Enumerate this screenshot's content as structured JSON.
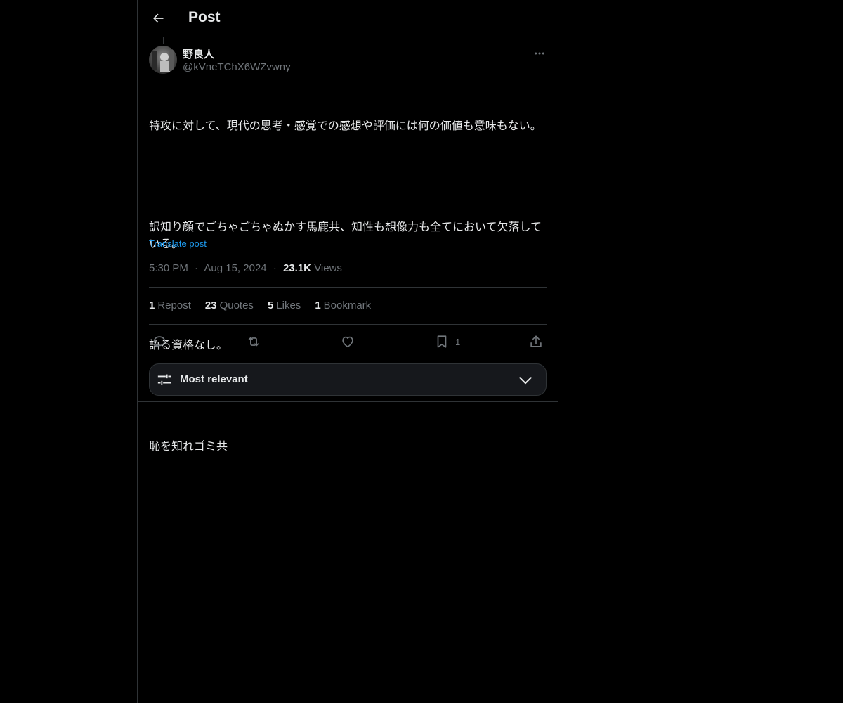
{
  "header": {
    "back_icon": "arrow-left-icon",
    "title": "Post"
  },
  "post": {
    "author": {
      "name": "野良人",
      "handle": "@kVneTChX6WZvwny",
      "avatar_icon": "avatar-photo"
    },
    "more_icon": "more-horizontal-icon",
    "paragraphs": [
      "特攻に対して、現代の思考・感覚での感想や評価には何の価値も意味もない。",
      "訳知り顔でごちゃごちゃぬかす馬鹿共、知性も想像力も全てにおいて欠落している。",
      "語る資格なし。",
      "恥を知れゴミ共"
    ],
    "translate_label": "Translate post",
    "time": "5:30 PM",
    "date": "Aug 15, 2024",
    "dot": "·",
    "views_count": "23.1K",
    "views_label": "Views"
  },
  "stats": {
    "reposts": {
      "num": "1",
      "label": "Repost"
    },
    "quotes": {
      "num": "23",
      "label": "Quotes"
    },
    "likes": {
      "num": "5",
      "label": "Likes"
    },
    "bookmarks": {
      "num": "1",
      "label": "Bookmark"
    }
  },
  "actions": {
    "reply_icon": "reply-icon",
    "repost_icon": "repost-icon",
    "like_icon": "heart-icon",
    "bookmark_icon": "bookmark-icon",
    "bookmark_count": "1",
    "share_icon": "share-icon"
  },
  "sort": {
    "icon": "sliders-icon",
    "label": "Most relevant",
    "chevron_icon": "chevron-down-icon"
  },
  "colors": {
    "background": "#000000",
    "text_primary": "#e7e9ea",
    "text_secondary": "#71767b",
    "accent": "#1d9bf0",
    "border": "#2f3336"
  }
}
